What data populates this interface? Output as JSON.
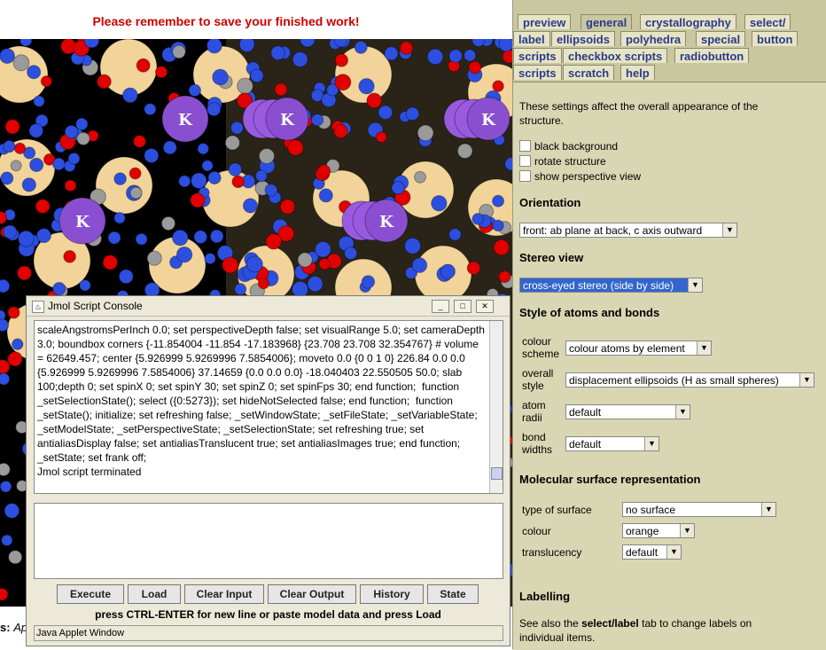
{
  "banner": {
    "text": "Please remember to save your finished work!"
  },
  "viewer": {
    "k_label": "K",
    "colors": {
      "potassium": "#8a4fd0",
      "potassium_shadow": "#9a5ae0",
      "large_atom": "#f2d49a",
      "blue_atom": "#2d4fe0",
      "red_atom": "#e00000",
      "grey_atom": "#9a9a9a"
    }
  },
  "caption": {
    "bold": "s:",
    "italic": "Ap"
  },
  "tabs": [
    {
      "label": "preview"
    },
    {
      "label": "general"
    },
    {
      "label": "crystallography"
    },
    {
      "label": "select/"
    },
    {
      "label": "label"
    },
    {
      "label": "ellipsoids"
    },
    {
      "label": "polyhedra"
    },
    {
      "label": "special"
    },
    {
      "label": "button"
    },
    {
      "label": "scripts"
    },
    {
      "label": "checkbox scripts"
    },
    {
      "label": "radiobutton"
    },
    {
      "label": "scripts"
    },
    {
      "label": "scratch"
    },
    {
      "label": "help"
    }
  ],
  "panel": {
    "intro": "These settings affect the overall appearance of the structure.",
    "checkboxes": [
      "black background",
      "rotate structure",
      "show perspective view"
    ],
    "orientation_heading": "Orientation",
    "orientation_value": "front: ab plane at back, c axis outward",
    "stereo_heading": "Stereo view",
    "stereo_value": "cross-eyed stereo (side by side)",
    "style_heading": "Style of atoms and bonds",
    "colour_scheme_label": "colour scheme",
    "colour_scheme_value": "colour atoms by element",
    "overall_style_label": "overall style",
    "overall_style_value": "displacement ellipsoids (H as small spheres)",
    "atom_radii_label": "atom radii",
    "atom_radii_value": "default",
    "bond_widths_label": "bond widths",
    "bond_widths_value": "default",
    "surface_heading": "Molecular surface representation",
    "surface_type_label": "type of surface",
    "surface_type_value": "no surface",
    "surface_colour_label": "colour",
    "surface_colour_value": "orange",
    "translucency_label": "translucency",
    "translucency_value": "default",
    "labelling_heading": "Labelling",
    "labelling_pre": "See also the ",
    "labelling_bold": "select/label",
    "labelling_post": " tab to change labels on individual items."
  },
  "console": {
    "title": "Jmol Script Console",
    "output": "scaleAngstromsPerInch 0.0; set perspectiveDepth false; set visualRange 5.0; set cameraDepth 3.0; boundbox corners {-11.854004 -11.854 -17.183968} {23.708 23.708 32.354767} # volume = 62649.457; center {5.926999 5.9269996 7.5854006}; moveto 0.0 {0 0 1 0} 226.84 0.0 0.0 {5.926999 5.9269996 7.5854006} 37.14659 {0.0 0.0 0.0} -18.040403 22.550505 50.0; slab 100;depth 0; set spinX 0; set spinY 30; set spinZ 0; set spinFps 30; end function;  function _setSelectionState(); select ({0:5273}); set hideNotSelected false; end function;  function _setState(); initialize; set refreshing false; _setWindowState; _setFileState; _setVariableState; _setModelState; _setPerspectiveState; _setSelectionState; set refreshing true; set antialiasDisplay false; set antialiasTranslucent true; set antialiasImages true; end function;  _setState; set frank off;\nJmol script terminated",
    "buttons": [
      "Execute",
      "Load",
      "Clear Input",
      "Clear Output",
      "History",
      "State"
    ],
    "hint": "press CTRL-ENTER for new line or paste model data and press Load",
    "status": "Java Applet Window"
  }
}
